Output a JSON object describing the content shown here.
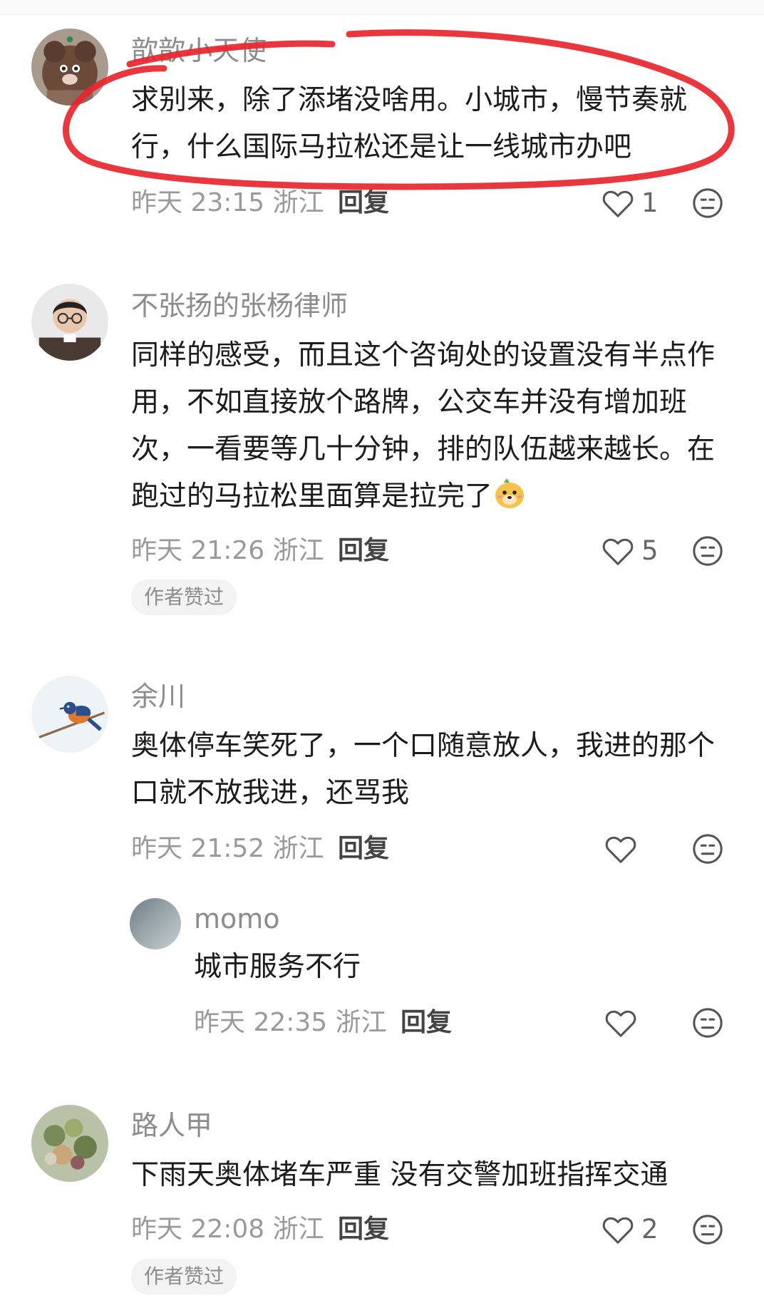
{
  "comments": [
    {
      "name": "歆歆小天使",
      "text": "求别来，除了添堵没啥用。小城市，慢节奏就行，什么国际马拉松还是让一线城市办吧",
      "time": "昨天 23:15 浙江",
      "reply": "回复",
      "likes": "1"
    },
    {
      "name": "不张扬的张杨律师",
      "text": "同样的感受，而且这个咨询处的设置没有半点作用，不如直接放个路牌，公交车并没有增加班次，一看要等几十分钟，排的队伍越来越长。在跑过的马拉松里面算是拉完了",
      "time": "昨天 21:26 浙江",
      "reply": "回复",
      "likes": "5",
      "badge": "作者赞过"
    },
    {
      "name": "余川",
      "text": "奥体停车笑死了，一个口随意放人，我进的那个口就不放我进，还骂我",
      "time": "昨天 21:52 浙江",
      "reply": "回复",
      "likes": "",
      "sub_reply": {
        "name": "momo",
        "text": "城市服务不行",
        "time": "昨天 22:35 浙江",
        "reply": "回复"
      }
    },
    {
      "name": "路人甲",
      "text": "下雨天奥体堵车严重 没有交警加班指挥交通",
      "time": "昨天 22:08 浙江",
      "reply": "回复",
      "likes": "2",
      "badge": "作者赞过"
    }
  ],
  "icons": {
    "like": "heart-outline-icon",
    "react": "meh-face-icon",
    "inline_emoji": "dog-face-emoji"
  },
  "colors": {
    "annotation": "#e8262c",
    "name": "#8c8c8c",
    "meta": "#9a9a9a"
  }
}
